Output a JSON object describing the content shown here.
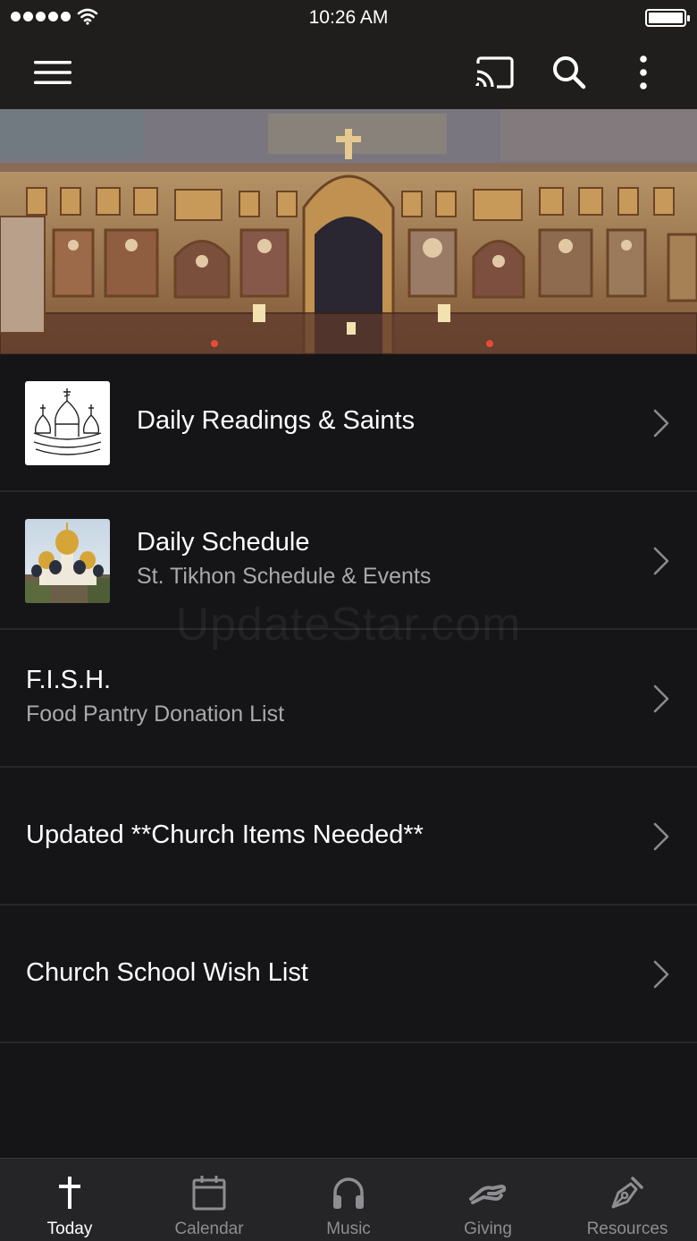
{
  "status_bar": {
    "time": "10:26 AM"
  },
  "app_bar": {
    "menu_icon": "hamburger-menu-icon",
    "cast_icon": "cast-icon",
    "search_icon": "search-icon",
    "more_icon": "more-vertical-icon"
  },
  "hero": {
    "image": "iconostasis-church-interior"
  },
  "list": {
    "items": [
      {
        "title": "Daily Readings & Saints",
        "subtitle": "",
        "thumbnail": "church-domes-drawing"
      },
      {
        "title": "Daily Schedule",
        "subtitle": "St. Tikhon Schedule & Events",
        "thumbnail": "cathedral-golden-domes-photo"
      },
      {
        "title": "F.I.S.H.",
        "subtitle": "Food Pantry Donation List"
      },
      {
        "title": "Updated **Church Items Needed**",
        "subtitle": ""
      },
      {
        "title": "Church School Wish List",
        "subtitle": ""
      }
    ]
  },
  "watermark": "UpdateStar.com",
  "tabbar": {
    "active": "Today",
    "tabs": [
      {
        "label": "Today",
        "icon": "cross-icon"
      },
      {
        "label": "Calendar",
        "icon": "calendar-icon"
      },
      {
        "label": "Music",
        "icon": "headphones-icon"
      },
      {
        "label": "Giving",
        "icon": "giving-hand-icon"
      },
      {
        "label": "Resources",
        "icon": "pen-nib-icon"
      }
    ]
  },
  "colors": {
    "background": "#151518",
    "bar": "#1f1e1c",
    "tabbar": "#252528",
    "subtitle": "#a9a9ad",
    "inactive_tab": "#8e8e92"
  }
}
